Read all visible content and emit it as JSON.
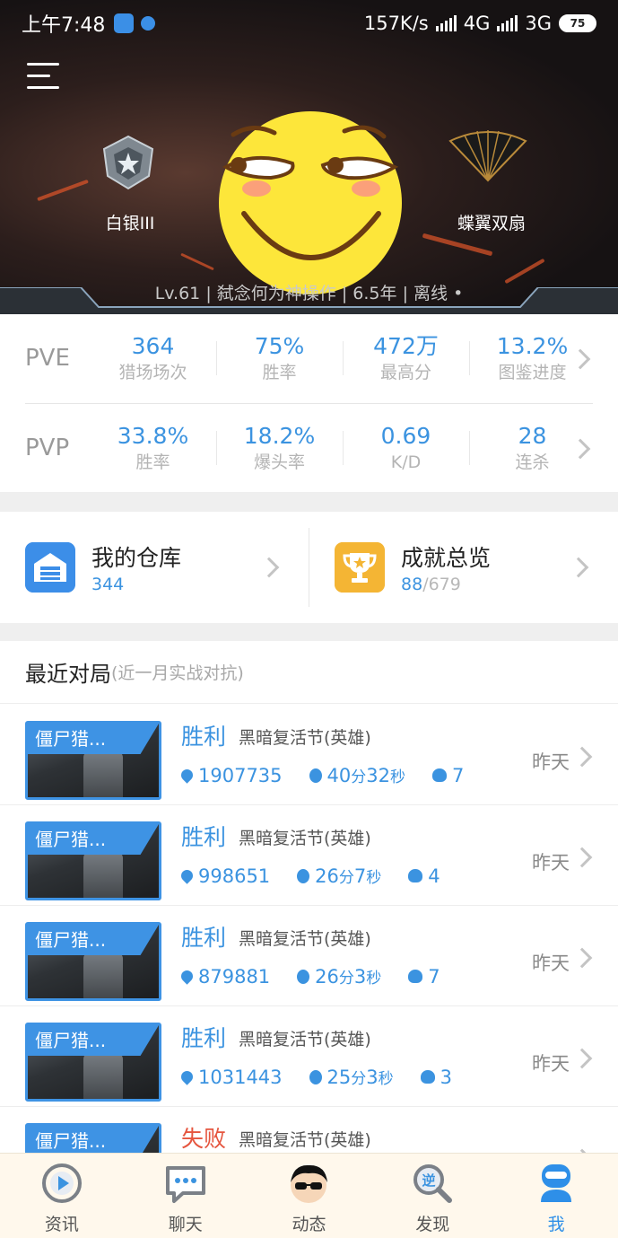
{
  "status_bar": {
    "time": "上午7:48",
    "speed": "157K/s",
    "network1": "4G",
    "network2": "3G",
    "battery": "75"
  },
  "profile": {
    "rank_label": "白银III",
    "weapon_label": "蝶翼双扇",
    "level": "Lv.61",
    "name": "弑念何为神操作",
    "years": "6.5年",
    "status": "离线",
    "separator": "|"
  },
  "pve": {
    "label": "PVE",
    "stats": [
      {
        "value": "364",
        "caption": "猎场场次"
      },
      {
        "value": "75%",
        "caption": "胜率"
      },
      {
        "value": "472万",
        "caption": "最高分"
      },
      {
        "value": "13.2%",
        "caption": "图鉴进度"
      }
    ]
  },
  "pvp": {
    "label": "PVP",
    "stats": [
      {
        "value": "33.8%",
        "caption": "胜率"
      },
      {
        "value": "18.2%",
        "caption": "爆头率"
      },
      {
        "value": "0.69",
        "caption": "K/D"
      },
      {
        "value": "28",
        "caption": "连杀"
      }
    ]
  },
  "warehouse": {
    "title": "我的仓库",
    "count": "344"
  },
  "achievements": {
    "title": "成就总览",
    "current": "88",
    "total": "/679"
  },
  "recent": {
    "title": "最近对局",
    "subtitle": "(近一月实战对抗)",
    "matches": [
      {
        "thumb": "僵尸猎...",
        "result": "胜利",
        "mode": "黑暗复活节(英雄)",
        "score": "1907735",
        "min": "40",
        "sec": "32",
        "kills": "7",
        "when": "昨天"
      },
      {
        "thumb": "僵尸猎...",
        "result": "胜利",
        "mode": "黑暗复活节(英雄)",
        "score": "998651",
        "min": "26",
        "sec": "7",
        "kills": "4",
        "when": "昨天"
      },
      {
        "thumb": "僵尸猎...",
        "result": "胜利",
        "mode": "黑暗复活节(英雄)",
        "score": "879881",
        "min": "26",
        "sec": "3",
        "kills": "7",
        "when": "昨天"
      },
      {
        "thumb": "僵尸猎...",
        "result": "胜利",
        "mode": "黑暗复活节(英雄)",
        "score": "1031443",
        "min": "25",
        "sec": "3",
        "kills": "3",
        "when": "昨天"
      },
      {
        "thumb": "僵尸猎...",
        "result": "失败",
        "mode": "黑暗复活节(英雄)",
        "score": "",
        "min": "",
        "sec": "",
        "kills": "",
        "when": ""
      }
    ],
    "min_unit": "分",
    "sec_unit": "秒"
  },
  "tabs": [
    {
      "label": "资讯",
      "icon": "news-play-icon"
    },
    {
      "label": "聊天",
      "icon": "chat-bubble-icon"
    },
    {
      "label": "动态",
      "icon": "avatar-sunglasses-icon"
    },
    {
      "label": "发现",
      "icon": "discover-magnifier-icon"
    },
    {
      "label": "我",
      "icon": "me-robot-icon"
    }
  ],
  "colors": {
    "accent": "#3b93e0",
    "win": "#3b93e0",
    "lose": "#e5553e",
    "trophy": "#f4b534"
  }
}
